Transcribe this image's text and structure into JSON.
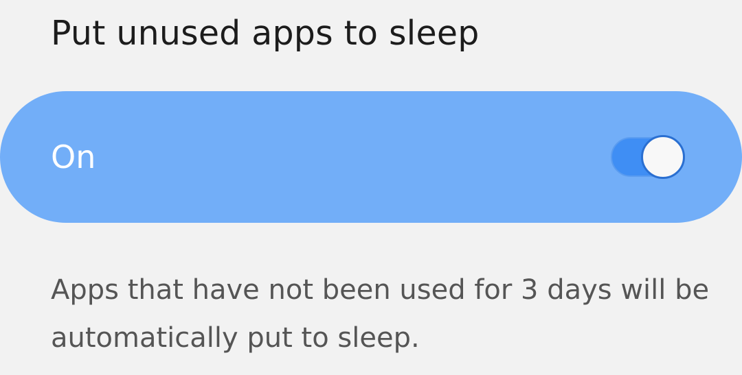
{
  "header": {
    "title": "Put unused apps to sleep"
  },
  "master_switch": {
    "label": "On",
    "state": true,
    "bar_color": "#72aef8",
    "toggle_color": "#3f8ef4"
  },
  "description": {
    "text": "Apps that have not been used for 3 days will be automatically put to sleep."
  }
}
